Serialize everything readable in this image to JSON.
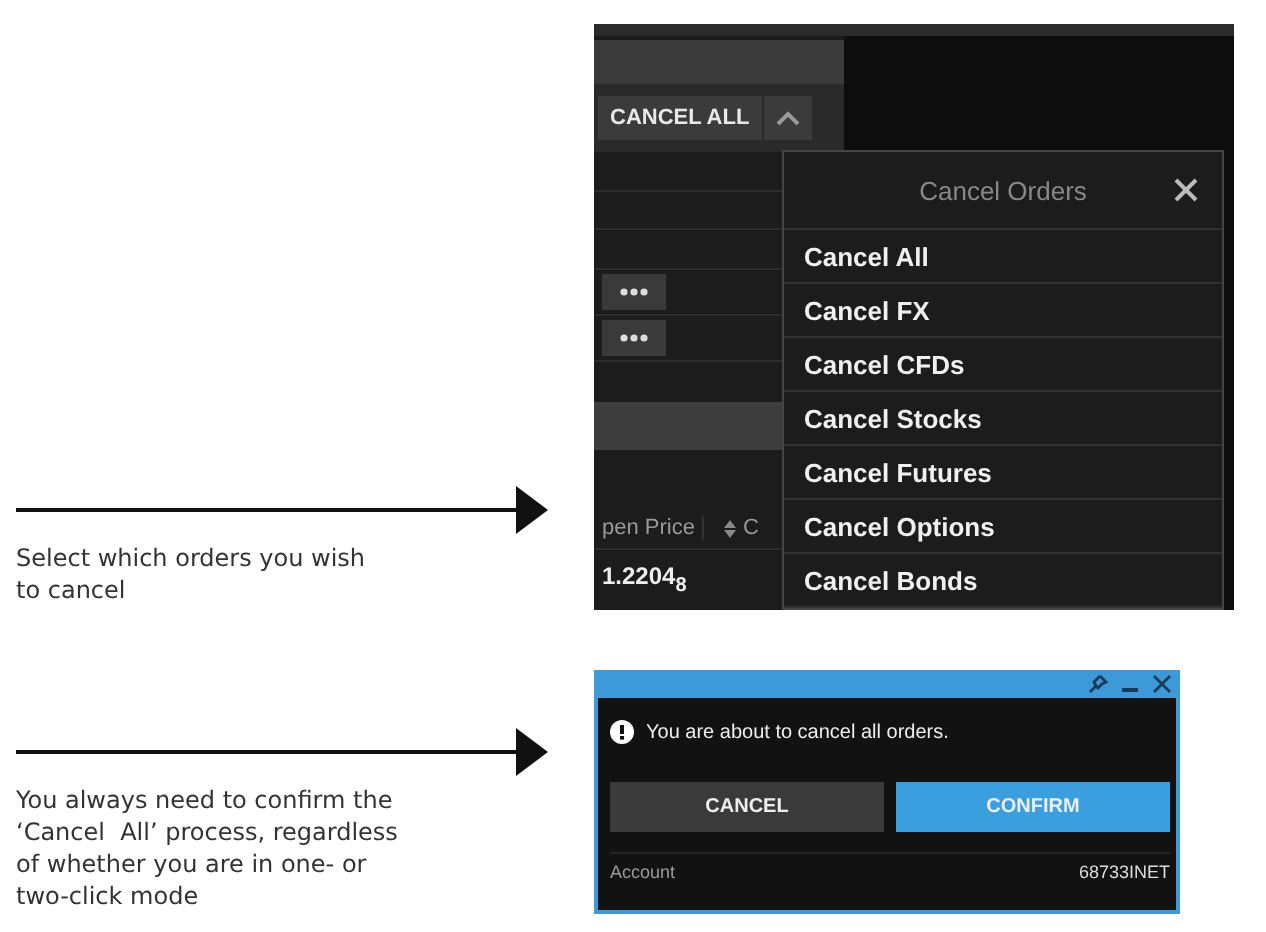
{
  "steps": [
    {
      "caption": "Select which orders you wish to cancel"
    },
    {
      "caption": "You always need to confirm the ‘Cancel  All’ process, regardless of whether you are in one- or two-click mode"
    }
  ],
  "orders_panel": {
    "cancel_all_button": "CANCEL ALL",
    "expanded": true,
    "columns": [
      {
        "label": "pen Price",
        "sortable": false
      },
      {
        "label": "C",
        "sortable": true
      }
    ],
    "rows": [
      {
        "cells": [
          "1.2204$_{8}$"
        ]
      }
    ]
  },
  "cancel_menu": {
    "title": "Cancel Orders",
    "items": [
      "Cancel All",
      "Cancel FX",
      "Cancel CFDs",
      "Cancel Stocks",
      "Cancel Futures",
      "Cancel Options",
      "Cancel Bonds"
    ]
  },
  "confirm_dialog": {
    "message": "You are about to cancel all orders.",
    "buttons": [
      {
        "label": "CANCEL",
        "kind": "secondary"
      },
      {
        "label": "CONFIRM",
        "kind": "primary"
      }
    ],
    "footer": {
      "label": "Account",
      "value": "68733INET"
    }
  }
}
